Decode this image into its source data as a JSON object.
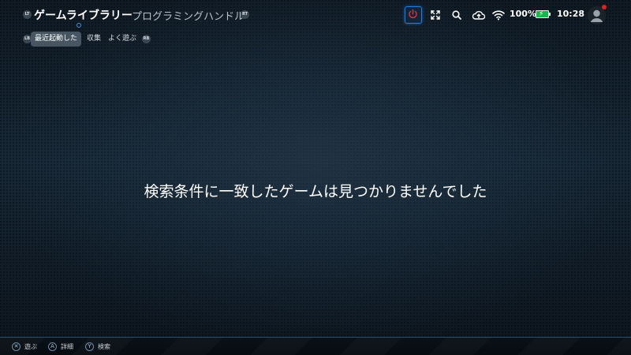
{
  "topbar": {
    "lt_hint": "LT",
    "rt_hint": "RT",
    "title": "ゲームライブラリー",
    "subtitle": "プログラミングハンドル",
    "battery_percent": "100%",
    "clock": "10:28",
    "battery_color": "#22b24c",
    "accent_color": "#1e7fe0"
  },
  "subtabs": {
    "lb_hint": "LB",
    "rb_hint": "RB",
    "items": [
      {
        "label": "最近起動した",
        "active": true
      },
      {
        "label": "収集",
        "active": false
      },
      {
        "label": "よく遊ぶ",
        "active": false
      }
    ]
  },
  "main": {
    "empty_message": "検索条件に一致したゲームは見つかりませんでした"
  },
  "bottombar": {
    "hints": [
      {
        "button": "✕",
        "label": "遊ぶ"
      },
      {
        "button": "A",
        "label": "詳細"
      },
      {
        "button": "Y",
        "label": "検索"
      }
    ]
  },
  "icons": [
    "power-icon",
    "fullscreen-icon",
    "search-icon",
    "cloud-upload-icon",
    "wifi-icon",
    "battery-icon",
    "user-avatar-icon"
  ]
}
